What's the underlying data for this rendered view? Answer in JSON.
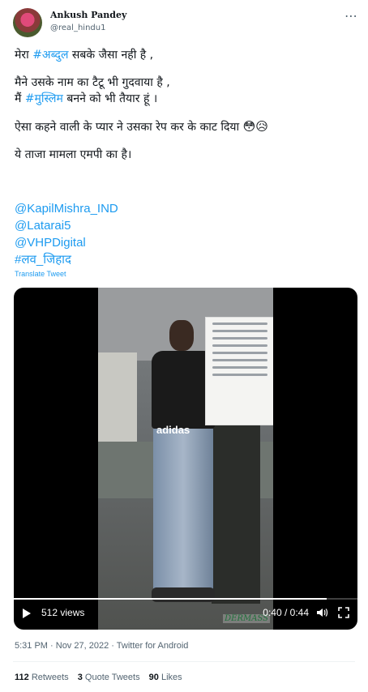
{
  "author": {
    "name": "Ankush Pandey",
    "handle": "@real_hindu1"
  },
  "more_icon": "ellipsis-icon",
  "tweet": {
    "line1_prefix": "मेरा ",
    "line1_hashtag": "#अब्दुल",
    "line1_suffix": " सबके जैसा नही है ,",
    "line2": "मैने उसके नाम का टैटू भी गुदवाया है ,",
    "line3_prefix": "मैं ",
    "line3_hashtag": "#मुस्लिम",
    "line3_suffix": " बनने को भी तैयार हूं ।",
    "line4": "ऐसा कहने वाली के प्यार ने उसका रेप कर के काट दिया ",
    "line4_emojis": "😳😥",
    "line5": "ये ताजा मामला एमपी का है।"
  },
  "mentions": [
    "@KapilMishra_IND",
    "@Latarai5",
    "@VHPDigital",
    "#लव_जिहाद"
  ],
  "translate_label": "Translate Tweet",
  "media": {
    "shirt_text": "adidas",
    "watermark": "DERMASS",
    "views": "512 views",
    "time": "0:40 / 0:44",
    "progress": 0.91,
    "icons": [
      "play-icon",
      "volume-icon",
      "fullscreen-icon"
    ]
  },
  "meta": {
    "time": "5:31 PM",
    "separator1": " · ",
    "date": "Nov 27, 2022",
    "separator2": " · ",
    "source": "Twitter for Android"
  },
  "stats": {
    "retweets_count": "112",
    "retweets_label": "Retweets",
    "quotes_count": "3",
    "quotes_label": "Quote Tweets",
    "likes_count": "90",
    "likes_label": "Likes"
  },
  "colors": {
    "link": "#1d9bf0",
    "text": "#0f1419",
    "secondary": "#536471"
  }
}
